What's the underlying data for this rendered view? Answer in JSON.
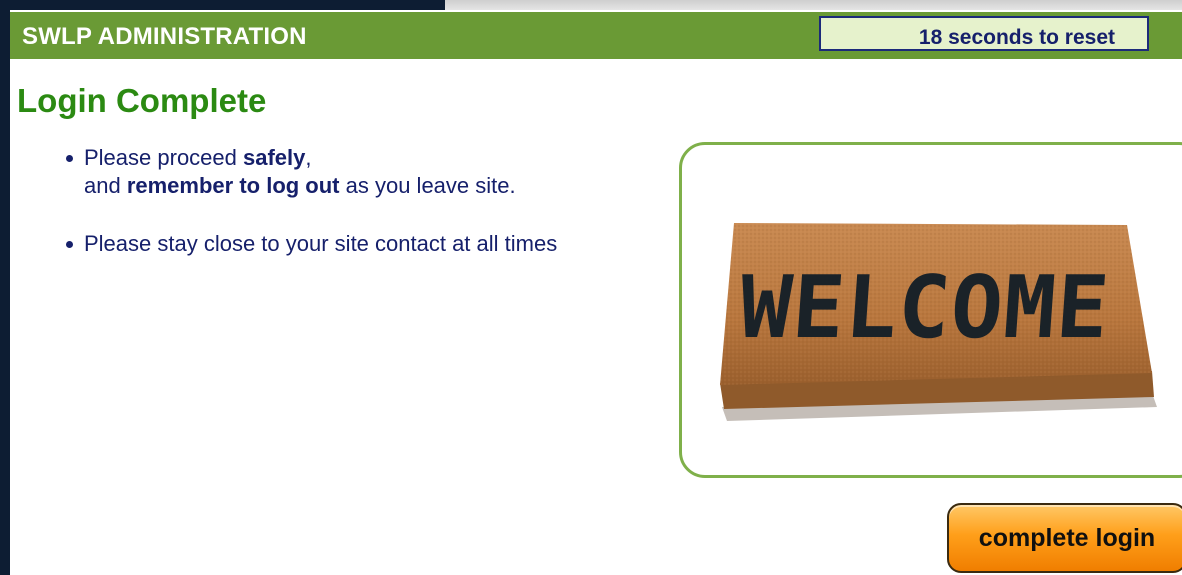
{
  "header": {
    "title": "SWLP ADMINISTRATION",
    "countdown": "18 seconds to reset"
  },
  "main": {
    "title": "Login Complete",
    "notes": [
      {
        "pre": "Please proceed ",
        "bold1": "safely",
        "mid": ",",
        "line2_pre": "and ",
        "bold2": "remember to log out",
        "line2_post": " as you leave site."
      },
      {
        "text": "Please stay close to your site contact at all times"
      }
    ]
  },
  "image": {
    "mat_text": "WELCOME"
  },
  "actions": {
    "complete_label": "complete login"
  },
  "colors": {
    "header_bg": "#6a9a35",
    "title_green": "#2b8a12",
    "text_navy": "#16206b",
    "button_orange": "#ff9f1a"
  }
}
